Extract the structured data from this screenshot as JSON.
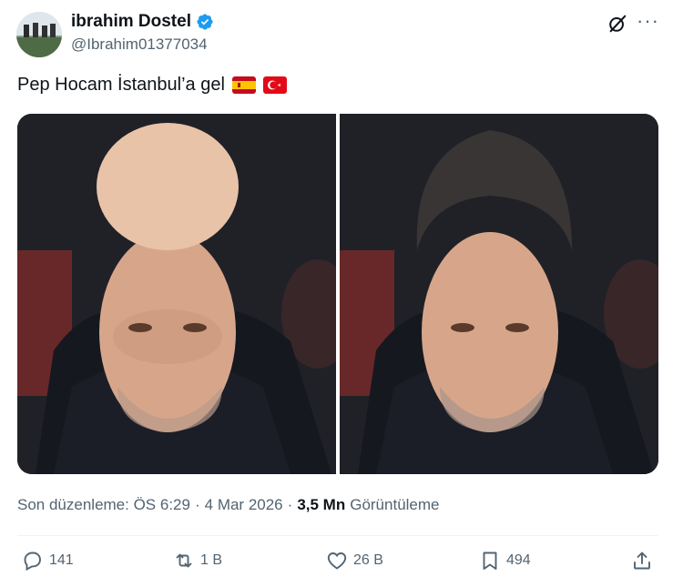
{
  "post": {
    "author": {
      "display_name": "ibrahim Dostel",
      "handle": "@Ibrahim01377034",
      "verified": true
    },
    "text": "Pep Hocam İstanbul’a gel",
    "flags": [
      "spain-flag",
      "turkey-flag"
    ],
    "media": [
      {
        "icon": "bald-man-photo",
        "description_icon": "photo"
      },
      {
        "icon": "slicked-hair-man-photo",
        "description_icon": "photo"
      }
    ],
    "meta": {
      "edited_label": "Son düzenleme: ÖS 6:29",
      "separator1": "·",
      "date": "4 Mar 2026",
      "separator2": "·",
      "views_count": "3,5 Mn",
      "views_label": "Görüntüleme"
    },
    "actions": {
      "replies": "141",
      "reposts": "1 B",
      "likes": "26 B",
      "bookmarks": "494"
    }
  },
  "colors": {
    "text_primary": "#0f1419",
    "text_secondary": "#536471",
    "verified_blue": "#1d9bf0",
    "divider": "#eff3f4"
  }
}
